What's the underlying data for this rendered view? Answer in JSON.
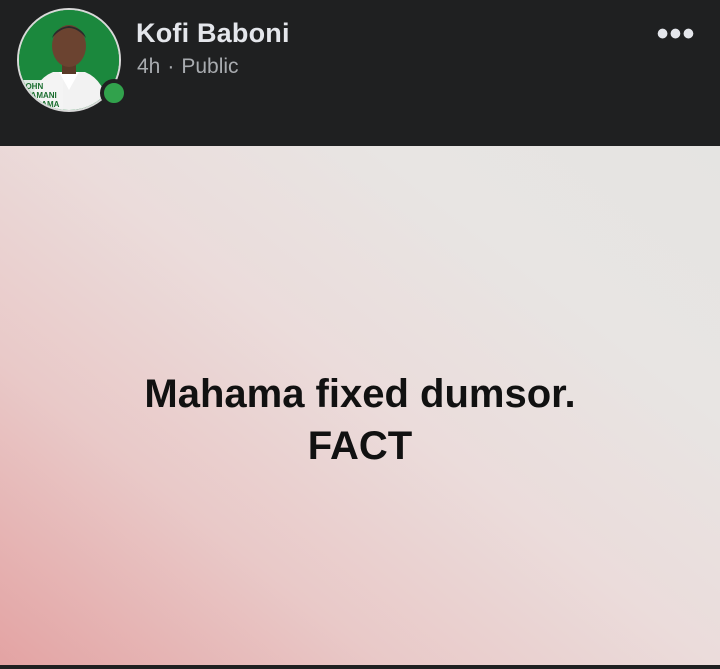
{
  "post": {
    "author": "Kofi Baboni",
    "time": "4h",
    "separator": "·",
    "audience": "Public",
    "body_line1": "Mahama fixed dumsor.",
    "body_line2": "FACT"
  },
  "avatar": {
    "caption_lines": [
      "JOHN",
      "DRAMANI",
      "MAHAMA"
    ]
  },
  "icons": {
    "more": "more-horizontal-icon",
    "online": "online-status-icon"
  },
  "colors": {
    "header_bg": "#1f2021",
    "name_text": "#e4e6eb",
    "meta_text": "#a8abaf",
    "online_green": "#31a24c",
    "body_text": "#111111"
  }
}
